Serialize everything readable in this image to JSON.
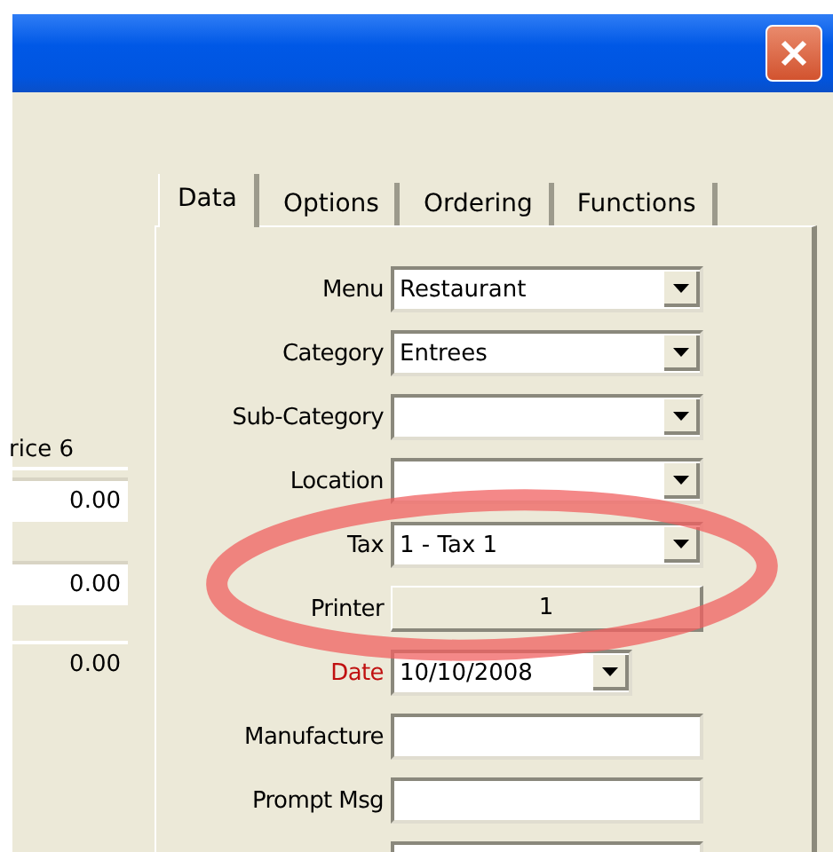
{
  "prices": {
    "header": "rice 6",
    "values": [
      {
        "value": "0.00",
        "disabled": false
      },
      {
        "value": "0.00",
        "disabled": false
      },
      {
        "value": "0.00",
        "disabled": true
      }
    ]
  },
  "tabs": [
    {
      "label": "Data",
      "selected": true
    },
    {
      "label": "Options",
      "selected": false
    },
    {
      "label": "Ordering",
      "selected": false
    },
    {
      "label": "Functions",
      "selected": false
    }
  ],
  "fields": [
    {
      "kind": "combo",
      "label": "Menu",
      "value": "Restaurant",
      "color": "#000000"
    },
    {
      "kind": "combo",
      "label": "Category",
      "value": "Entrees",
      "color": "#000000"
    },
    {
      "kind": "combo",
      "label": "Sub-Category",
      "color": "#000000"
    },
    {
      "kind": "combo",
      "label": "Location",
      "color": "#000000"
    },
    {
      "kind": "combo",
      "label": "Tax",
      "value": "1 - Tax 1",
      "color": "#000000"
    },
    {
      "kind": "button",
      "label": "Printer",
      "value": "1",
      "color": "#000000"
    },
    {
      "kind": "date",
      "label": "Date",
      "value": "10/10/2008",
      "color": "#c01010"
    },
    {
      "kind": "text",
      "label": "Manufacture",
      "color": "#000000"
    },
    {
      "kind": "text",
      "label": "Prompt Msg",
      "color": "#000000"
    },
    {
      "kind": "text"
    }
  ]
}
